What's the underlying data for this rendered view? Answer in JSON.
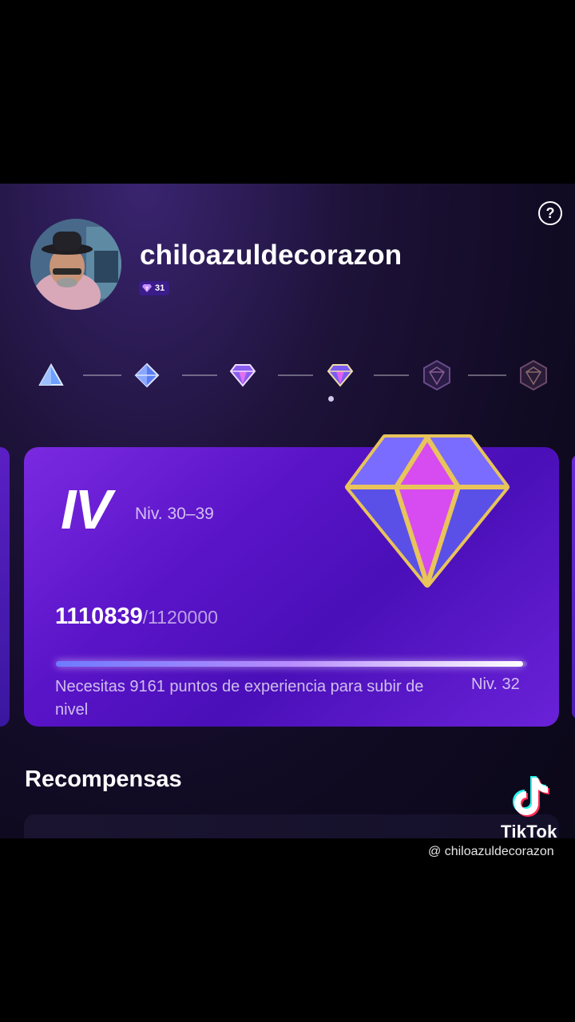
{
  "profile": {
    "username": "chiloazuldecorazon",
    "level": "31"
  },
  "tiers": [
    {
      "name": "tier-1",
      "state": "unlocked"
    },
    {
      "name": "tier-2",
      "state": "unlocked"
    },
    {
      "name": "tier-3",
      "state": "unlocked"
    },
    {
      "name": "tier-4",
      "state": "current"
    },
    {
      "name": "tier-5",
      "state": "locked"
    },
    {
      "name": "tier-6",
      "state": "locked"
    }
  ],
  "card": {
    "roman": "IV",
    "range": "Niv. 30–39",
    "xp_current": "1110839",
    "xp_total": "/1120000",
    "progress_fraction": 0.991,
    "note": "Necesitas 9161 puntos de experiencia para subir de nivel",
    "next_level": "Niv. 32"
  },
  "rewards": {
    "title": "Recompensas"
  },
  "watermark": {
    "brand": "TikTok",
    "handle": "@ chiloazuldecorazon"
  },
  "icons": {
    "help": "help-icon",
    "gem": "diamond-gem-icon"
  },
  "colors": {
    "accent": "#6a1ed8",
    "gem_gold": "#e8c45a",
    "gem_pink": "#d64cf0"
  }
}
